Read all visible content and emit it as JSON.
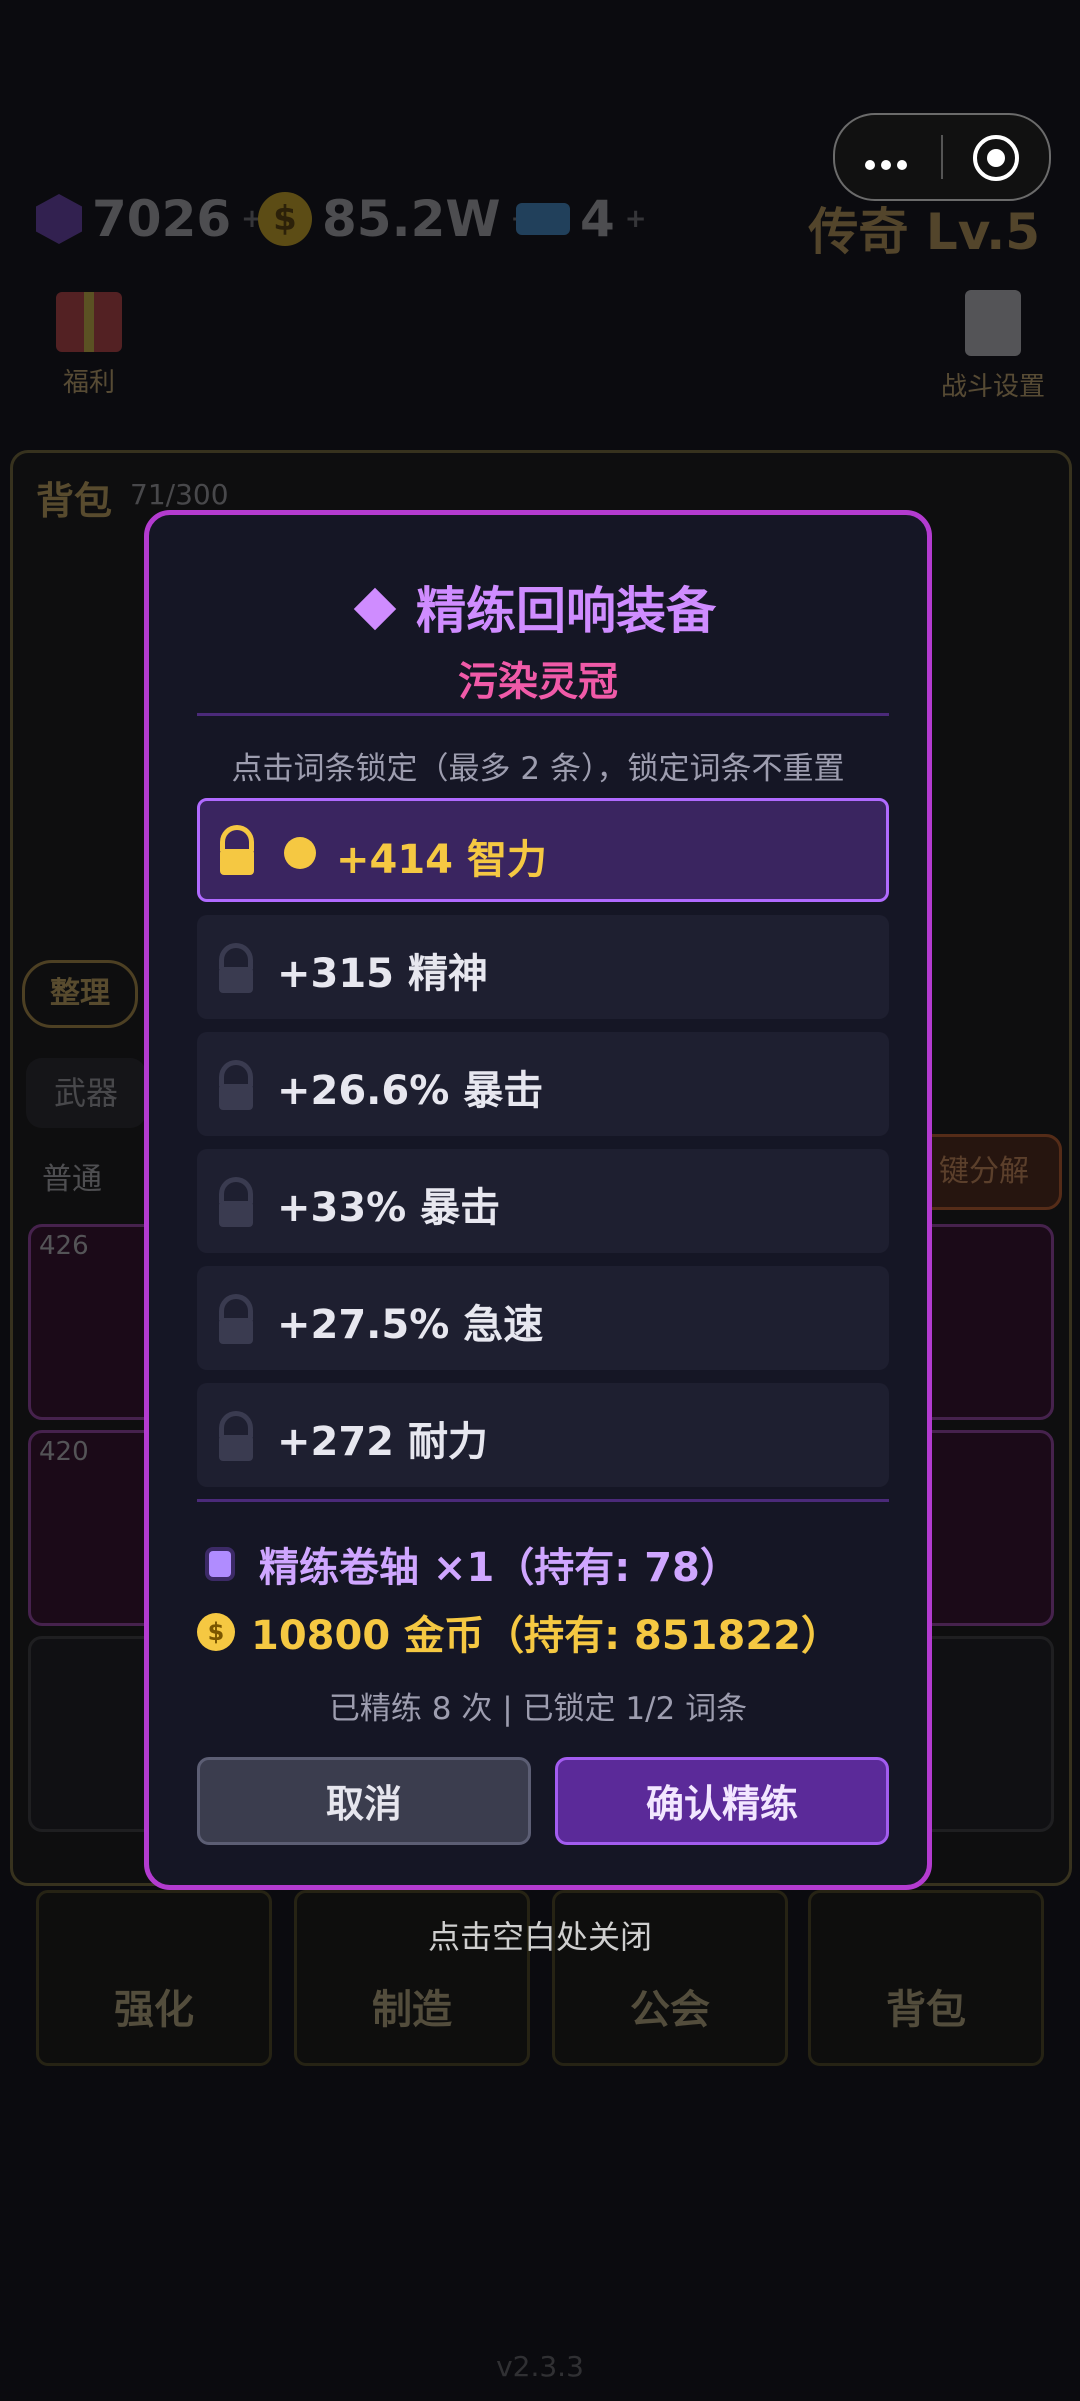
{
  "topbar": {
    "gems": "7026",
    "gold": "85.2W",
    "tickets": "4",
    "rank": "传奇 Lv.5",
    "plus": "+"
  },
  "side": {
    "welfare": "福利",
    "battle_settings": "战斗设置"
  },
  "bag": {
    "title": "背包",
    "count": "71/300",
    "tidy": "整理",
    "tab_weapon": "武器",
    "filter_normal": "普通",
    "decompose": "键分解",
    "slots": [
      {
        "lv": "426"
      },
      {
        "lv": "420"
      }
    ]
  },
  "bottom_nav": {
    "strengthen": "强化",
    "craft": "制造",
    "guild": "公会",
    "backpack": "背包"
  },
  "hint": "点击空白处关闭",
  "version": "v2.3.3",
  "modal": {
    "title": "精练回响装备",
    "subtitle": "污染灵冠",
    "tip": "点击词条锁定（最多 2 条），锁定词条不重置",
    "affixes": [
      {
        "text": "+414 智力",
        "locked": true
      },
      {
        "text": "+315 精神",
        "locked": false
      },
      {
        "text": "+26.6% 暴击",
        "locked": false
      },
      {
        "text": "+33% 暴击",
        "locked": false
      },
      {
        "text": "+27.5% 急速",
        "locked": false
      },
      {
        "text": "+272 耐力",
        "locked": false
      }
    ],
    "cost_scroll": "精练卷轴 ×1（持有: 78）",
    "cost_gold": "10800 金币（持有: 851822）",
    "status": "已精练 8 次 | 已锁定 1/2 词条",
    "cancel": "取消",
    "confirm": "确认精练"
  },
  "colors": {
    "accent_purple": "#b33bd0",
    "title_purple": "#cf8cff",
    "subtitle_pink": "#f05aa8",
    "gold": "#f5c842"
  },
  "icons": [
    "gem-icon",
    "coin-icon",
    "ticket-icon",
    "gift-icon",
    "clipboard-icon",
    "more-icon",
    "target-icon",
    "diamond-icon",
    "lock-icon",
    "scroll-icon"
  ]
}
